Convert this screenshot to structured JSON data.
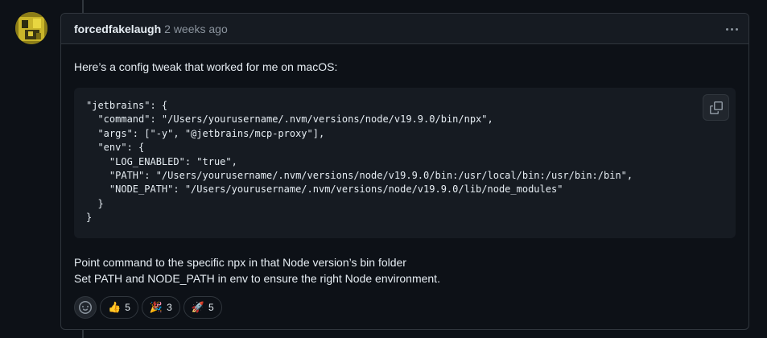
{
  "comment": {
    "author": "forcedfakelaugh",
    "timestamp": "2 weeks ago",
    "intro": "Here’s a config tweak that worked for me on macOS:",
    "code_lines": [
      "\"jetbrains\": {",
      "  \"command\": \"/Users/yourusername/.nvm/versions/node/v19.9.0/bin/npx\",",
      "  \"args\": [\"-y\", \"@jetbrains/mcp-proxy\"],",
      "  \"env\": {",
      "    \"LOG_ENABLED\": \"true\",",
      "    \"PATH\": \"/Users/yourusername/.nvm/versions/node/v19.9.0/bin:/usr/local/bin:/usr/bin:/bin\",",
      "    \"NODE_PATH\": \"/Users/yourusername/.nvm/versions/node/v19.9.0/lib/node_modules\"",
      "  }",
      "}"
    ],
    "note_1": "Point command to the specific npx in that Node version’s bin folder",
    "note_2": "Set PATH and NODE_PATH in env to ensure the right Node environment."
  },
  "reactions": [
    {
      "emoji": "👍",
      "icon": "thumbs-up-icon",
      "count": "5"
    },
    {
      "emoji": "🎉",
      "icon": "party-popper-icon",
      "count": "3"
    },
    {
      "emoji": "🚀",
      "icon": "rocket-icon",
      "count": "5"
    }
  ],
  "colors": {
    "background": "#0d1117",
    "header": "#161b22",
    "border": "#30363d",
    "muted": "#8b949e",
    "text": "#e6edf3"
  }
}
